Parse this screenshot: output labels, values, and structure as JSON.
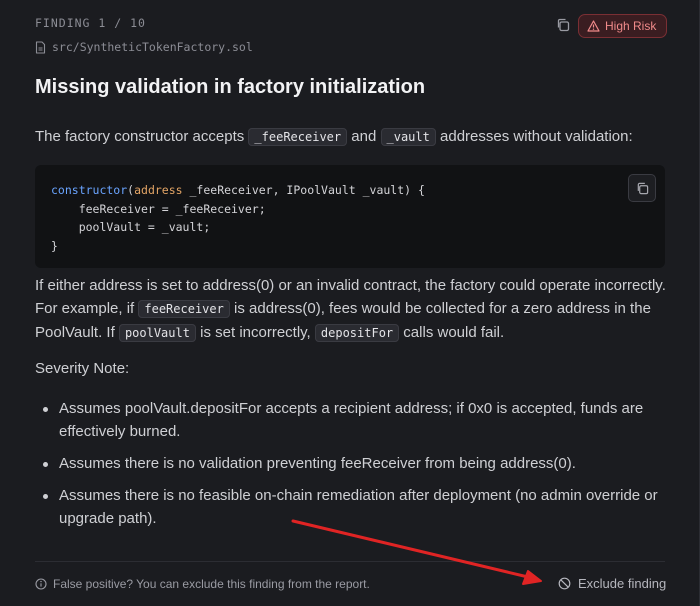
{
  "header": {
    "finding_label": "FINDING 1 / 10",
    "risk_label": "High Risk",
    "file_path": "src/SyntheticTokenFactory.sol"
  },
  "title": "Missing validation in factory initialization",
  "intro": {
    "before": "The factory constructor accepts ",
    "code1": "_feeReceiver",
    "mid": " and ",
    "code2": "_vault",
    "after": " addresses without validation:"
  },
  "code": {
    "line1_kw": "constructor",
    "line1_a": "(",
    "line1_type": "address",
    "line1_b": " _feeReceiver, IPoolVault _vault) {",
    "line2": "    feeReceiver = _feeReceiver;",
    "line3": "    poolVault = _vault;",
    "line4": "}"
  },
  "explanation": {
    "t1": "If either address is set to address(0) or an invalid contract, the factory could operate incorrectly. For example, if ",
    "c1": "feeReceiver",
    "t2": " is address(0), fees would be collected for a zero address in the PoolVault. If ",
    "c2": "poolVault",
    "t3": " is set incorrectly, ",
    "c3": "depositFor",
    "t4": " calls would fail."
  },
  "severity_note_label": "Severity Note:",
  "severity_bullets": [
    "Assumes poolVault.depositFor accepts a recipient address; if 0x0 is accepted, funds are effectively burned.",
    "Assumes there is no validation preventing feeReceiver from being address(0).",
    "Assumes there is no feasible on-chain remediation after deployment (no admin override or upgrade path)."
  ],
  "footer": {
    "hint": "False positive? You can exclude this finding from the report.",
    "exclude_label": "Exclude finding"
  },
  "icons": {
    "copy": "copy-icon",
    "warning": "warning-triangle-icon",
    "file": "file-icon",
    "info": "info-circle-icon",
    "ban": "ban-icon"
  },
  "colors": {
    "background": "#1b1c20",
    "risk_text": "#f08a8a",
    "risk_bg": "#3a1d21",
    "annotation_arrow": "#e02424"
  }
}
